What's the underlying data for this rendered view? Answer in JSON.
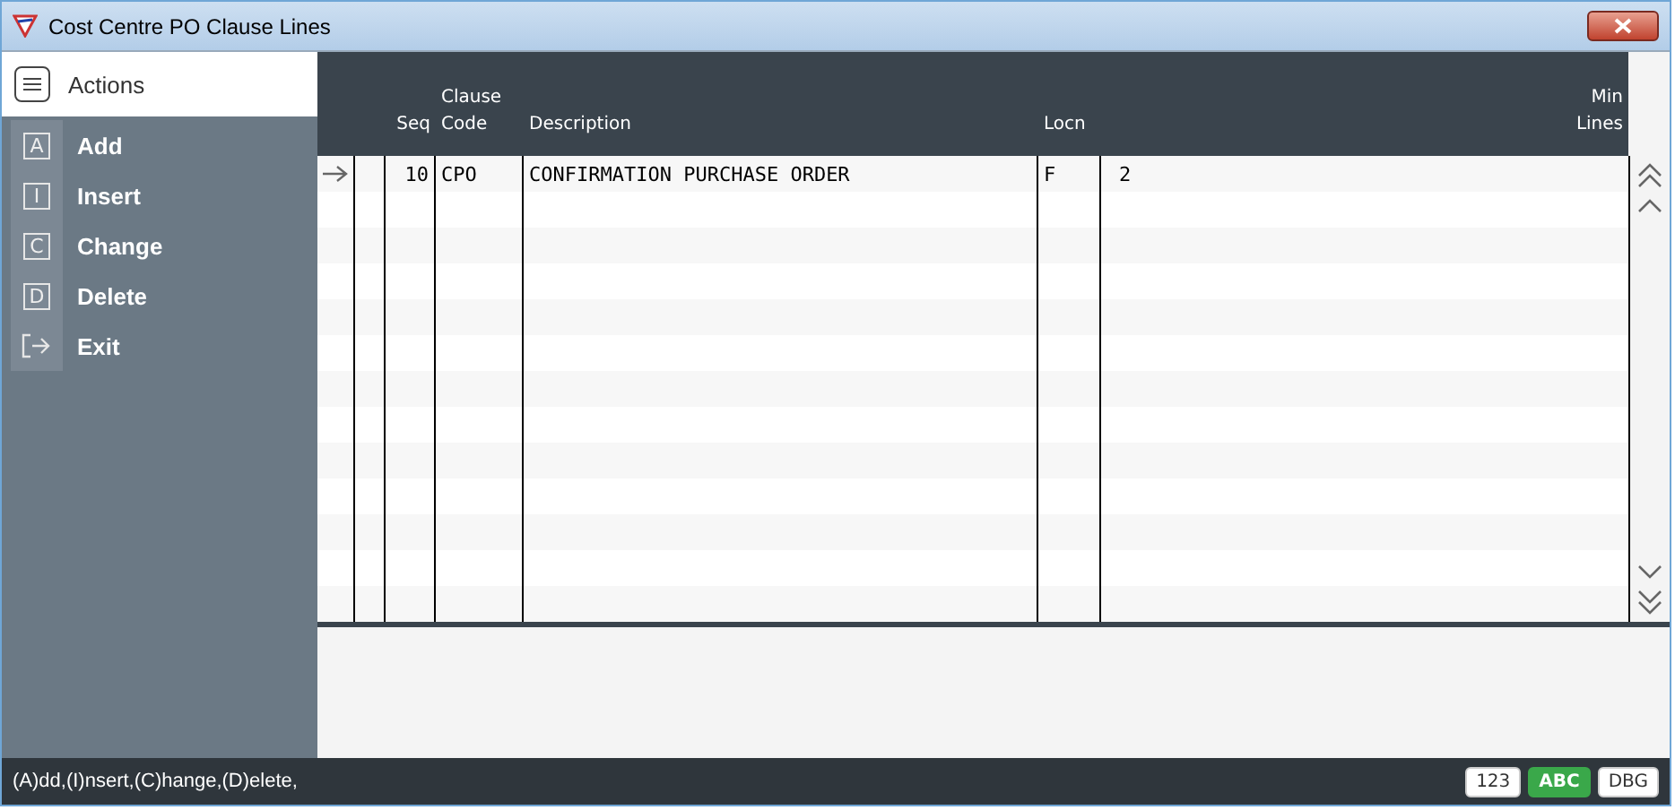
{
  "window": {
    "title": "Cost Centre PO Clause Lines"
  },
  "sidebar": {
    "title": "Actions",
    "items": [
      {
        "key": "A",
        "label": "Add",
        "kind": "key"
      },
      {
        "key": "I",
        "label": "Insert",
        "kind": "key"
      },
      {
        "key": "C",
        "label": "Change",
        "kind": "key"
      },
      {
        "key": "D",
        "label": "Delete",
        "kind": "key"
      },
      {
        "label": "Exit",
        "kind": "exit"
      }
    ]
  },
  "table": {
    "columns": [
      {
        "label": "Seq"
      },
      {
        "label": "Clause\nCode"
      },
      {
        "label": "Description"
      },
      {
        "label": "Locn"
      },
      {
        "label": "Min\nLines"
      }
    ],
    "rows": [
      {
        "selected": true,
        "cells": [
          "10",
          "CPO",
          "CONFIRMATION PURCHASE ORDER",
          "F",
          "2"
        ]
      }
    ]
  },
  "status_bar": {
    "hint": "(A)dd,(I)nsert,(C)hange,(D)elete,",
    "badges": [
      {
        "label": "123",
        "on": false
      },
      {
        "label": "ABC",
        "on": true
      },
      {
        "label": "DBG",
        "on": false
      }
    ]
  }
}
